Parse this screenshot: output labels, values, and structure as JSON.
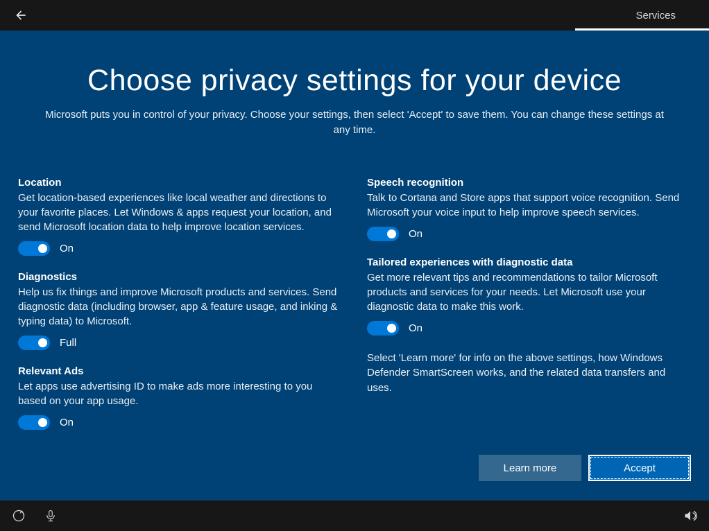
{
  "header": {
    "step_label": "Services"
  },
  "main": {
    "title": "Choose privacy settings for your device",
    "subtitle": "Microsoft puts you in control of your privacy. Choose your settings, then select 'Accept' to save them. You can change these settings at any time."
  },
  "settings": {
    "location": {
      "title": "Location",
      "desc": "Get location-based experiences like local weather and directions to your favorite places. Let Windows & apps request your location, and send Microsoft location data to help improve location services.",
      "state": "On"
    },
    "diagnostics": {
      "title": "Diagnostics",
      "desc": "Help us fix things and improve Microsoft products and services. Send diagnostic data (including browser, app & feature usage, and inking & typing data) to Microsoft.",
      "state": "Full"
    },
    "ads": {
      "title": "Relevant Ads",
      "desc": "Let apps use advertising ID to make ads more interesting to you based on your app usage.",
      "state": "On"
    },
    "speech": {
      "title": "Speech recognition",
      "desc": "Talk to Cortana and Store apps that support voice recognition. Send Microsoft your voice input to help improve speech services.",
      "state": "On"
    },
    "tailored": {
      "title": "Tailored experiences with diagnostic data",
      "desc": "Get more relevant tips and recommendations to tailor Microsoft products and services for your needs. Let Microsoft use your diagnostic data to make this work.",
      "state": "On"
    },
    "info_text": "Select 'Learn more' for info on the above settings, how Windows Defender SmartScreen works, and the related data transfers and uses."
  },
  "buttons": {
    "learn_more": "Learn more",
    "accept": "Accept"
  }
}
